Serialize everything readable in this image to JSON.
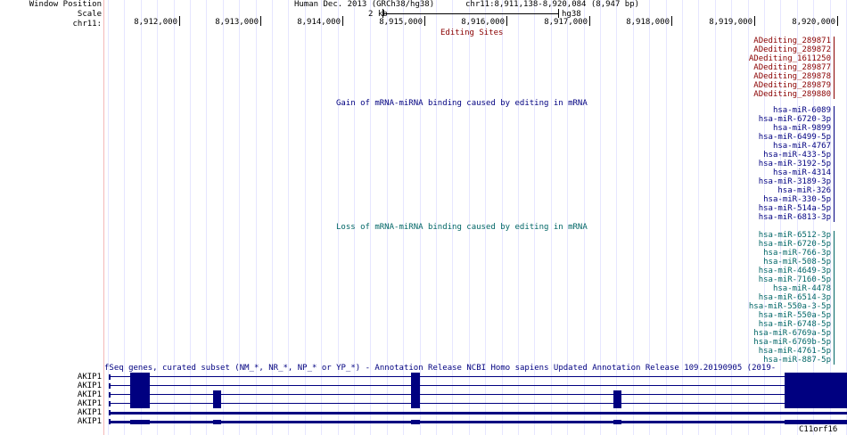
{
  "header": {
    "window_position_label": "Window Position",
    "scale_label": "Scale",
    "chrom_label": "chr11:",
    "assembly": "Human Dec. 2013 (GRCh38/hg38)",
    "position": "chr11:8,911,138-8,920,084 (8,947 bp)",
    "scale_value": "2 kb",
    "scale_assembly": "hg38"
  },
  "ruler": {
    "ticks": [
      "8,912,000",
      "8,913,000",
      "8,914,000",
      "8,915,000",
      "8,916,000",
      "8,917,000",
      "8,918,000",
      "8,919,000",
      "8,920,000"
    ]
  },
  "editing_track": {
    "title": "Editing Sites",
    "items": [
      "ADediting_289871",
      "ADediting_289872",
      "ADediting_1611250",
      "ADediting_289877",
      "ADediting_289878",
      "ADediting_289879",
      "ADediting_289880"
    ]
  },
  "gain_track": {
    "title": "Gain of mRNA-miRNA binding caused by editing in mRNA",
    "items": [
      "hsa-miR-6089",
      "hsa-miR-6720-3p",
      "hsa-miR-9899",
      "hsa-miR-6499-5p",
      "hsa-miR-4767",
      "hsa-miR-433-5p",
      "hsa-miR-3192-5p",
      "hsa-miR-4314",
      "hsa-miR-3189-3p",
      "hsa-miR-326",
      "hsa-miR-330-5p",
      "hsa-miR-514a-5p",
      "hsa-miR-6813-3p"
    ]
  },
  "loss_track": {
    "title": "Loss of mRNA-miRNA binding caused by editing in mRNA",
    "items": [
      "hsa-miR-6512-3p",
      "hsa-miR-6720-5p",
      "hsa-miR-766-3p",
      "hsa-miR-508-5p",
      "hsa-miR-4649-3p",
      "hsa-miR-7160-5p",
      "hsa-miR-4478",
      "hsa-miR-6514-3p",
      "hsa-miR-550a-3-5p",
      "hsa-miR-550a-5p",
      "hsa-miR-6748-5p",
      "hsa-miR-6769a-5p",
      "hsa-miR-6769b-5p",
      "hsa-miR-4761-5p",
      "hsa-miR-887-5p"
    ]
  },
  "genes_track": {
    "title": "fSeq genes, curated subset (NM_*, NR_*, NP_* or YP_*) - Annotation Release NCBI Homo sapiens Updated Annotation Release 109.20190905 (2019-",
    "rows": [
      {
        "name": "AKIP1"
      },
      {
        "name": "AKIP1"
      },
      {
        "name": "AKIP1"
      },
      {
        "name": "AKIP1"
      },
      {
        "name": "AKIP1"
      },
      {
        "name": "AKIP1"
      }
    ],
    "bottom_label": "C11orf16"
  },
  "colors": {
    "gene_blue": "#000080",
    "edit_red": "#8a0000",
    "loss_teal": "#006666"
  }
}
